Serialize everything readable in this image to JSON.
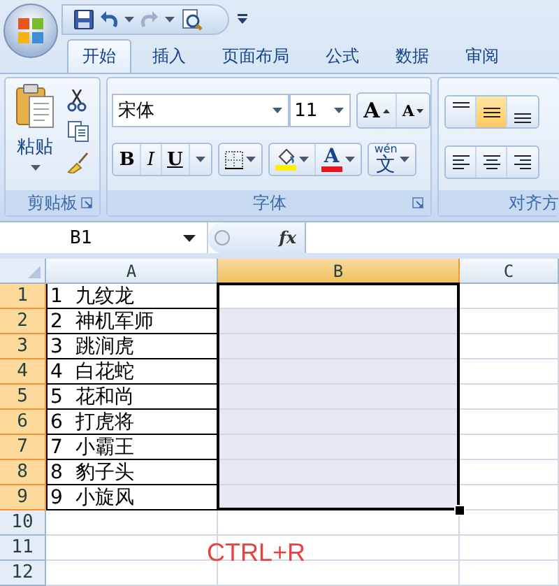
{
  "tabs": [
    {
      "label": "开始",
      "selected": true
    },
    {
      "label": "插入",
      "selected": false
    },
    {
      "label": "页面布局",
      "selected": false
    },
    {
      "label": "公式",
      "selected": false
    },
    {
      "label": "数据",
      "selected": false
    },
    {
      "label": "审阅",
      "selected": false
    }
  ],
  "ribbon": {
    "clipboard": {
      "paste": "粘贴",
      "label": "剪贴板"
    },
    "font": {
      "font_name": "宋体",
      "font_size": "11",
      "grow": "A",
      "shrink": "A",
      "bold": "B",
      "italic": "I",
      "underline": "U",
      "font_color": "A",
      "phonetic_ruby": "wén",
      "phonetic_char": "文",
      "label": "字体"
    },
    "alignment": {
      "vertical": [
        {
          "selected": false
        },
        {
          "selected": true
        },
        {
          "selected": false
        }
      ],
      "label": "对齐方"
    }
  },
  "formula_bar": {
    "name_box": "B1",
    "function_label": "fx"
  },
  "sheet": {
    "columns": [
      {
        "label": "A",
        "selected": false
      },
      {
        "label": "B",
        "selected": true
      },
      {
        "label": "C",
        "selected": false
      }
    ],
    "rows": [
      {
        "header": "1",
        "selected": true,
        "a": "1  九纹龙"
      },
      {
        "header": "2",
        "selected": true,
        "a": "2  神机军师"
      },
      {
        "header": "3",
        "selected": true,
        "a": "3  跳涧虎"
      },
      {
        "header": "4",
        "selected": true,
        "a": "4  白花蛇"
      },
      {
        "header": "5",
        "selected": true,
        "a": "5  花和尚"
      },
      {
        "header": "6",
        "selected": true,
        "a": "6  打虎将"
      },
      {
        "header": "7",
        "selected": true,
        "a": "7  小霸王"
      },
      {
        "header": "8",
        "selected": true,
        "a": "8  豹子头"
      },
      {
        "header": "9",
        "selected": true,
        "a": "9  小旋风"
      },
      {
        "header": "10",
        "selected": false
      },
      {
        "header": "11",
        "selected": false
      },
      {
        "header": "12",
        "selected": false
      }
    ]
  },
  "annotation": "CTRL+R"
}
